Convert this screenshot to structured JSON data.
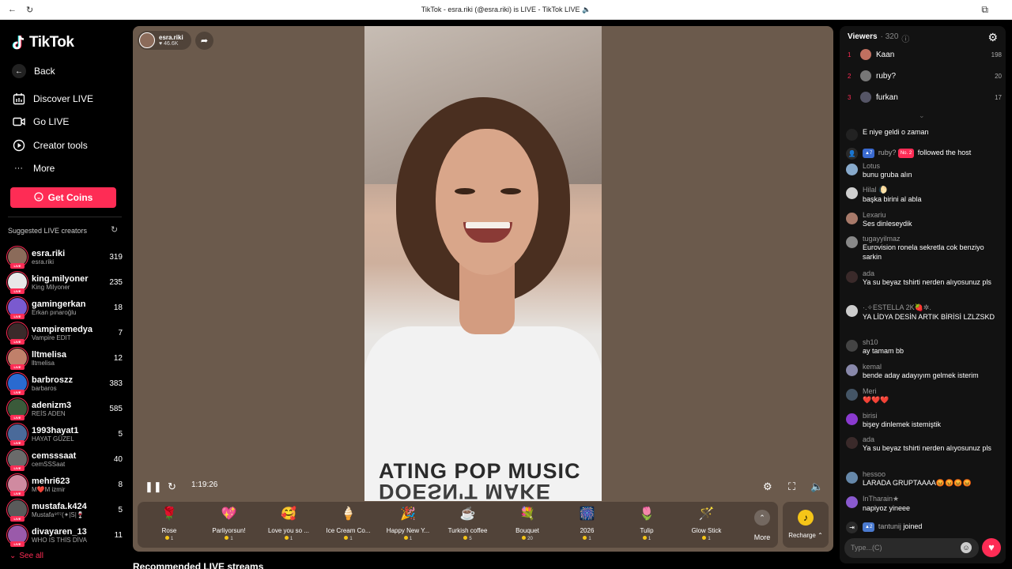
{
  "browser": {
    "title": "TikTok - esra.riki (@esra.riki) is LIVE - TikTok LIVE 🔈"
  },
  "sidebar": {
    "logo": "TikTok",
    "nav": [
      {
        "label": "Back"
      },
      {
        "label": "Discover LIVE"
      },
      {
        "label": "Go LIVE"
      },
      {
        "label": "Creator tools"
      },
      {
        "label": "More"
      }
    ],
    "coins_button": "Get Coins",
    "suggested_title": "Suggested LIVE creators",
    "live_badge": "LIVE",
    "creators": [
      {
        "name": "esra.riki",
        "sub": "esra.riki",
        "count": "319",
        "color": "#8b6b5a"
      },
      {
        "name": "king.milyoner",
        "sub": "King Milyoner",
        "count": "235",
        "color": "#e8e8e8"
      },
      {
        "name": "gamingerkan",
        "sub": "Erkan pınaroğlu",
        "count": "18",
        "color": "#7a5acf"
      },
      {
        "name": "vampiremedya",
        "sub": "Vampire EDIT",
        "count": "7",
        "color": "#3a2a2a"
      },
      {
        "name": "lltmelisa",
        "sub": "lltmelisa",
        "count": "12",
        "color": "#c0806a"
      },
      {
        "name": "barbroszz",
        "sub": "barbaros",
        "count": "383",
        "color": "#2a6ad0"
      },
      {
        "name": "adenizm3",
        "sub": "REİS ADEN",
        "count": "585",
        "color": "#3a5a3a"
      },
      {
        "name": "1993hayat1",
        "sub": "HAYAT GÜZEL",
        "count": "5",
        "color": "#4a6a9a"
      },
      {
        "name": "cemsssaat",
        "sub": "cemSSSaat",
        "count": "40",
        "color": "#6a6a6a"
      },
      {
        "name": "mehri623",
        "sub": "M❤️M izmir",
        "count": "8",
        "color": "#d08aa0"
      },
      {
        "name": "mustafa.k424",
        "sub": "Mustafa⁹⁰⁷(✦|S|🍷",
        "count": "5",
        "color": "#5a5a5a"
      },
      {
        "name": "divayaren_13",
        "sub": "WHO IS THİS DİVA",
        "count": "11",
        "color": "#9a5aaa"
      }
    ],
    "see_all": "See all"
  },
  "player": {
    "host_name": "esra.riki",
    "host_likes": "46.6K",
    "elapsed": "1:19:26",
    "shirt_text_1": "ATING POP MUSIC",
    "shirt_text_2": "DOESN'T MAKE",
    "gifts": [
      {
        "name": "Rose",
        "price": "1",
        "icon": "🌹"
      },
      {
        "name": "Parliyorsun!",
        "price": "1",
        "icon": "💖"
      },
      {
        "name": "Love you so ...",
        "price": "1",
        "icon": "🥰"
      },
      {
        "name": "Ice Cream Co...",
        "price": "1",
        "icon": "🍦"
      },
      {
        "name": "Happy New Y...",
        "price": "1",
        "icon": "🎉"
      },
      {
        "name": "Turkish coffee",
        "price": "5",
        "icon": "☕"
      },
      {
        "name": "Bouquet",
        "price": "20",
        "icon": "💐"
      },
      {
        "name": "2026",
        "price": "1",
        "icon": "🎆"
      },
      {
        "name": "Tulip",
        "price": "1",
        "icon": "🌷"
      },
      {
        "name": "Glow Stick",
        "price": "1",
        "icon": "🪄"
      }
    ],
    "more_label": "More",
    "recharge_label": "Recharge ⌃"
  },
  "recommended_title": "Recommended LIVE streams",
  "chat": {
    "viewers_label": "Viewers",
    "viewers_count": "· 320",
    "top_viewers": [
      {
        "rank": "1",
        "name": "Kaan",
        "score": "198",
        "color": "#c07060"
      },
      {
        "rank": "2",
        "name": "ruby?",
        "score": "20",
        "color": "#777"
      },
      {
        "rank": "3",
        "name": "furkan",
        "score": "17",
        "color": "#556"
      }
    ],
    "messages": [
      {
        "user": "",
        "text": "E niye geldi o zaman",
        "color": "#222"
      },
      {
        "user": "Lotus",
        "text": "bunu gruba alın",
        "color": "#88aacc"
      },
      {
        "user": "Hilal 🌔",
        "text": "başka birini al abla",
        "color": "#cfcfcf"
      },
      {
        "user": "Lexariu",
        "text": "Ses dinleseydik",
        "color": "#a87a6a"
      },
      {
        "user": "tugayyilmaz",
        "text": "Eurovision ronela sekretla cok benziyo sarkin",
        "color": "#888"
      },
      {
        "user": "ada",
        "text": "Ya su beyaz tshirti nerden alıyosunuz pls",
        "color": "#3a2a2a"
      },
      {
        "user": "·.✧ESTELLA 2K🍓✲.",
        "text": "YA LİDYA DESİN ARTIK BİRİSİ LZLZSKD",
        "color": "#ccc"
      },
      {
        "user": "sh10",
        "text": "ay tamam bb",
        "color": "#444"
      },
      {
        "user": "kemal",
        "text": "bende aday adayıyım gelmek isterim",
        "color": "#8888aa"
      },
      {
        "user": "Meri",
        "text": "❤️❤️❤️",
        "color": "#445566"
      },
      {
        "user": "birisi",
        "text": "bişey dinlemek istemiştik",
        "color": "#8a3acf"
      },
      {
        "user": "ada",
        "text": "Ya su beyaz tshirti nerden alıyosunuz pls",
        "color": "#3a2a2a"
      },
      {
        "user": "hessoo",
        "text": "LARADA GRUPTAAAA😡😡😡😡",
        "color": "#6688aa"
      },
      {
        "user": "InTharain★",
        "text": "napiyoz yineee",
        "color": "#8a5acf"
      }
    ],
    "follow_event": {
      "level": "7",
      "user": "ruby?",
      "rank_badge": "No. 2",
      "action": "followed the host"
    },
    "join_event": {
      "level": "2",
      "user": "tantunij",
      "action": "joined"
    },
    "input_placeholder": "Type...(C)"
  }
}
